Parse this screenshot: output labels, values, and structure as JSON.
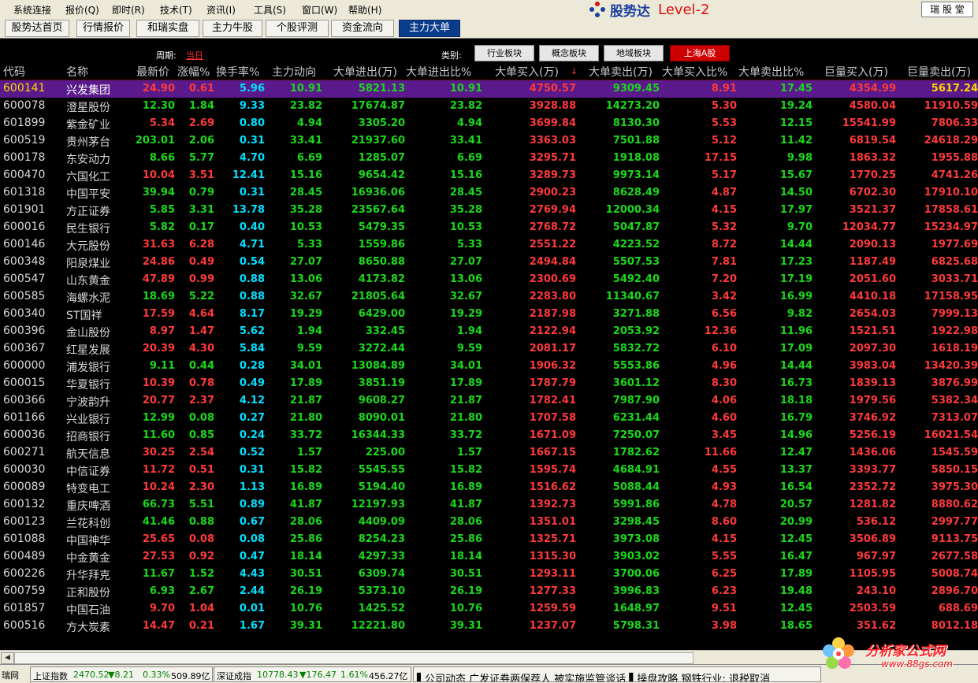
{
  "menu": {
    "items": [
      "系统连接",
      "报价(Q)",
      "即时(R)",
      "技术(T)",
      "资讯(I)",
      "工具(S)",
      "窗口(W)",
      "帮助(H)"
    ],
    "brand_name": "股势达",
    "brand_level": "Level-2",
    "user_button": "瑞 股 堂"
  },
  "nav": {
    "tabs": [
      "股势达首页",
      "行情报价",
      "和瑞实盘",
      "主力牛股",
      "个股评测",
      "资金流向",
      "主力大单"
    ],
    "active_index": 6
  },
  "filter": {
    "period_label": "周期:",
    "period_value": "当日",
    "category_label": "类别:",
    "categories": [
      "行业板块",
      "概念板块",
      "地域板块",
      "上海A股"
    ],
    "active_category": 3
  },
  "table": {
    "headers": [
      "代码",
      "名称",
      "最新价",
      "涨幅%",
      "换手率%",
      "主力动向",
      "大单进出(万)",
      "大单进出比%",
      "大单买入(万)",
      "大单卖出(万)",
      "大单买入比%",
      "大单卖出比%",
      "巨量买入(万)",
      "巨量卖出(万)"
    ],
    "sort_marker": "↓",
    "rows": [
      [
        "600141",
        "兴发集团",
        "24.90",
        "0.61",
        "5.96",
        "10.91",
        "5821.13",
        "10.91",
        "4750.57",
        "9309.45",
        "8.91",
        "17.45",
        "4354.99",
        "5617.24"
      ],
      [
        "600078",
        "澄星股份",
        "12.30",
        "1.84",
        "9.33",
        "23.82",
        "17674.87",
        "23.82",
        "3928.88",
        "14273.20",
        "5.30",
        "19.24",
        "4580.04",
        "11910.59"
      ],
      [
        "601899",
        "紫金矿业",
        "5.34",
        "2.69",
        "0.80",
        "4.94",
        "3305.20",
        "4.94",
        "3699.84",
        "8130.30",
        "5.53",
        "12.15",
        "15541.99",
        "7806.33"
      ],
      [
        "600519",
        "贵州茅台",
        "203.01",
        "2.06",
        "0.31",
        "33.41",
        "21937.60",
        "33.41",
        "3363.03",
        "7501.88",
        "5.12",
        "11.42",
        "6819.54",
        "24618.29"
      ],
      [
        "600178",
        "东安动力",
        "8.66",
        "5.77",
        "4.70",
        "6.69",
        "1285.07",
        "6.69",
        "3295.71",
        "1918.08",
        "17.15",
        "9.98",
        "1863.32",
        "1955.88"
      ],
      [
        "600470",
        "六国化工",
        "10.04",
        "3.51",
        "12.41",
        "15.16",
        "9654.42",
        "15.16",
        "3289.73",
        "9973.14",
        "5.17",
        "15.67",
        "1770.25",
        "4741.26"
      ],
      [
        "601318",
        "中国平安",
        "39.94",
        "0.79",
        "0.31",
        "28.45",
        "16936.06",
        "28.45",
        "2900.23",
        "8628.49",
        "4.87",
        "14.50",
        "6702.30",
        "17910.10"
      ],
      [
        "601901",
        "方正证券",
        "5.85",
        "3.31",
        "13.78",
        "35.28",
        "23567.64",
        "35.28",
        "2769.94",
        "12000.34",
        "4.15",
        "17.97",
        "3521.37",
        "17858.61"
      ],
      [
        "600016",
        "民生银行",
        "5.82",
        "0.17",
        "0.40",
        "10.53",
        "5479.35",
        "10.53",
        "2768.72",
        "5047.87",
        "5.32",
        "9.70",
        "12034.77",
        "15234.97"
      ],
      [
        "600146",
        "大元股份",
        "31.63",
        "6.28",
        "4.71",
        "5.33",
        "1559.86",
        "5.33",
        "2551.22",
        "4223.52",
        "8.72",
        "14.44",
        "2090.13",
        "1977.69"
      ],
      [
        "600348",
        "阳泉煤业",
        "24.86",
        "0.49",
        "0.54",
        "27.07",
        "8650.88",
        "27.07",
        "2494.84",
        "5507.53",
        "7.81",
        "17.23",
        "1187.49",
        "6825.68"
      ],
      [
        "600547",
        "山东黄金",
        "47.89",
        "0.99",
        "0.88",
        "13.06",
        "4173.82",
        "13.06",
        "2300.69",
        "5492.40",
        "7.20",
        "17.19",
        "2051.60",
        "3033.71"
      ],
      [
        "600585",
        "海螺水泥",
        "18.69",
        "5.22",
        "0.88",
        "32.67",
        "21805.64",
        "32.67",
        "2283.80",
        "11340.67",
        "3.42",
        "16.99",
        "4410.18",
        "17158.95"
      ],
      [
        "600340",
        "ST国祥",
        "17.59",
        "4.64",
        "8.17",
        "19.29",
        "6429.00",
        "19.29",
        "2187.98",
        "3271.88",
        "6.56",
        "9.82",
        "2654.03",
        "7999.13"
      ],
      [
        "600396",
        "金山股份",
        "8.97",
        "1.47",
        "5.62",
        "1.94",
        "332.45",
        "1.94",
        "2122.94",
        "2053.92",
        "12.36",
        "11.96",
        "1521.51",
        "1922.98"
      ],
      [
        "600367",
        "红星发展",
        "20.39",
        "4.30",
        "5.84",
        "9.59",
        "3272.44",
        "9.59",
        "2081.17",
        "5832.72",
        "6.10",
        "17.09",
        "2097.30",
        "1618.19"
      ],
      [
        "600000",
        "浦发银行",
        "9.11",
        "0.44",
        "0.28",
        "34.01",
        "13084.89",
        "34.01",
        "1906.32",
        "5553.86",
        "4.96",
        "14.44",
        "3983.04",
        "13420.39"
      ],
      [
        "600015",
        "华夏银行",
        "10.39",
        "0.78",
        "0.49",
        "17.89",
        "3851.19",
        "17.89",
        "1787.79",
        "3601.12",
        "8.30",
        "16.73",
        "1839.13",
        "3876.99"
      ],
      [
        "600366",
        "宁波韵升",
        "20.77",
        "2.37",
        "4.12",
        "21.87",
        "9608.27",
        "21.87",
        "1782.41",
        "7987.90",
        "4.06",
        "18.18",
        "1979.56",
        "5382.34"
      ],
      [
        "601166",
        "兴业银行",
        "12.99",
        "0.08",
        "0.27",
        "21.80",
        "8090.01",
        "21.80",
        "1707.58",
        "6231.44",
        "4.60",
        "16.79",
        "3746.92",
        "7313.07"
      ],
      [
        "600036",
        "招商银行",
        "11.60",
        "0.85",
        "0.24",
        "33.72",
        "16344.33",
        "33.72",
        "1671.09",
        "7250.07",
        "3.45",
        "14.96",
        "5256.19",
        "16021.54"
      ],
      [
        "600271",
        "航天信息",
        "30.25",
        "2.54",
        "0.52",
        "1.57",
        "225.00",
        "1.57",
        "1667.15",
        "1782.62",
        "11.66",
        "12.47",
        "1436.06",
        "1545.59"
      ],
      [
        "600030",
        "中信证券",
        "11.72",
        "0.51",
        "0.31",
        "15.82",
        "5545.55",
        "15.82",
        "1595.74",
        "4684.91",
        "4.55",
        "13.37",
        "3393.77",
        "5850.15"
      ],
      [
        "600089",
        "特变电工",
        "10.24",
        "2.30",
        "1.13",
        "16.89",
        "5194.40",
        "16.89",
        "1516.62",
        "5088.44",
        "4.93",
        "16.54",
        "2352.72",
        "3975.30"
      ],
      [
        "600132",
        "重庆啤酒",
        "66.73",
        "5.51",
        "0.89",
        "41.87",
        "12197.93",
        "41.87",
        "1392.73",
        "5991.86",
        "4.78",
        "20.57",
        "1281.82",
        "8880.62"
      ],
      [
        "600123",
        "兰花科创",
        "41.46",
        "0.88",
        "0.67",
        "28.06",
        "4409.09",
        "28.06",
        "1351.01",
        "3298.45",
        "8.60",
        "20.99",
        "536.12",
        "2997.77"
      ],
      [
        "601088",
        "中国神华",
        "25.65",
        "0.08",
        "0.08",
        "25.86",
        "8254.23",
        "25.86",
        "1325.71",
        "3973.08",
        "4.15",
        "12.45",
        "3506.89",
        "9113.75"
      ],
      [
        "600489",
        "中金黄金",
        "27.53",
        "0.92",
        "0.47",
        "18.14",
        "4297.33",
        "18.14",
        "1315.30",
        "3903.02",
        "5.55",
        "16.47",
        "967.97",
        "2677.58"
      ],
      [
        "600226",
        "升华拜克",
        "11.67",
        "1.52",
        "4.43",
        "30.51",
        "6309.74",
        "30.51",
        "1293.11",
        "3700.06",
        "6.25",
        "17.89",
        "1105.95",
        "5008.74"
      ],
      [
        "600759",
        "正和股份",
        "6.93",
        "2.67",
        "2.44",
        "26.19",
        "5373.10",
        "26.19",
        "1277.33",
        "3996.83",
        "6.23",
        "19.48",
        "243.10",
        "2896.70"
      ],
      [
        "601857",
        "中国石油",
        "9.70",
        "1.04",
        "0.01",
        "10.76",
        "1425.52",
        "10.76",
        "1259.59",
        "1648.97",
        "9.51",
        "12.45",
        "2503.59",
        "688.69"
      ],
      [
        "600516",
        "方大炭素",
        "14.47",
        "0.21",
        "1.67",
        "39.31",
        "12221.80",
        "39.31",
        "1237.07",
        "5798.31",
        "3.98",
        "18.65",
        "351.62",
        "8012.18"
      ]
    ],
    "red_price_rows": [
      0,
      2,
      5,
      9,
      10,
      11,
      13,
      14,
      15,
      17,
      18,
      21,
      22,
      23,
      26,
      27,
      30,
      31
    ]
  },
  "status": {
    "app": "瑞网",
    "sh_label": "上证指数",
    "sh_value": "2470.52",
    "sh_change": "▼8.21",
    "sh_pct": "0.33%",
    "sh_amount": "509.89亿",
    "sz_label": "深证成指",
    "sz_value": "10778.43",
    "sz_change": "▼176.47",
    "sz_pct": "1.61%",
    "sz_amount": "456.27亿",
    "ticker": "▌公司动态  广发证券两保荐人 被实施监管谈话 ▌操盘攻略  钢铁行业: 退税取消"
  },
  "watermark": {
    "title": "分析家公式网",
    "url": "www.88gs.com"
  },
  "colors": {
    "up": "#ff3a3a",
    "down": "#1ad81a",
    "selected_row": "#5a1a8c",
    "active_tab": "#0a3c8c"
  }
}
